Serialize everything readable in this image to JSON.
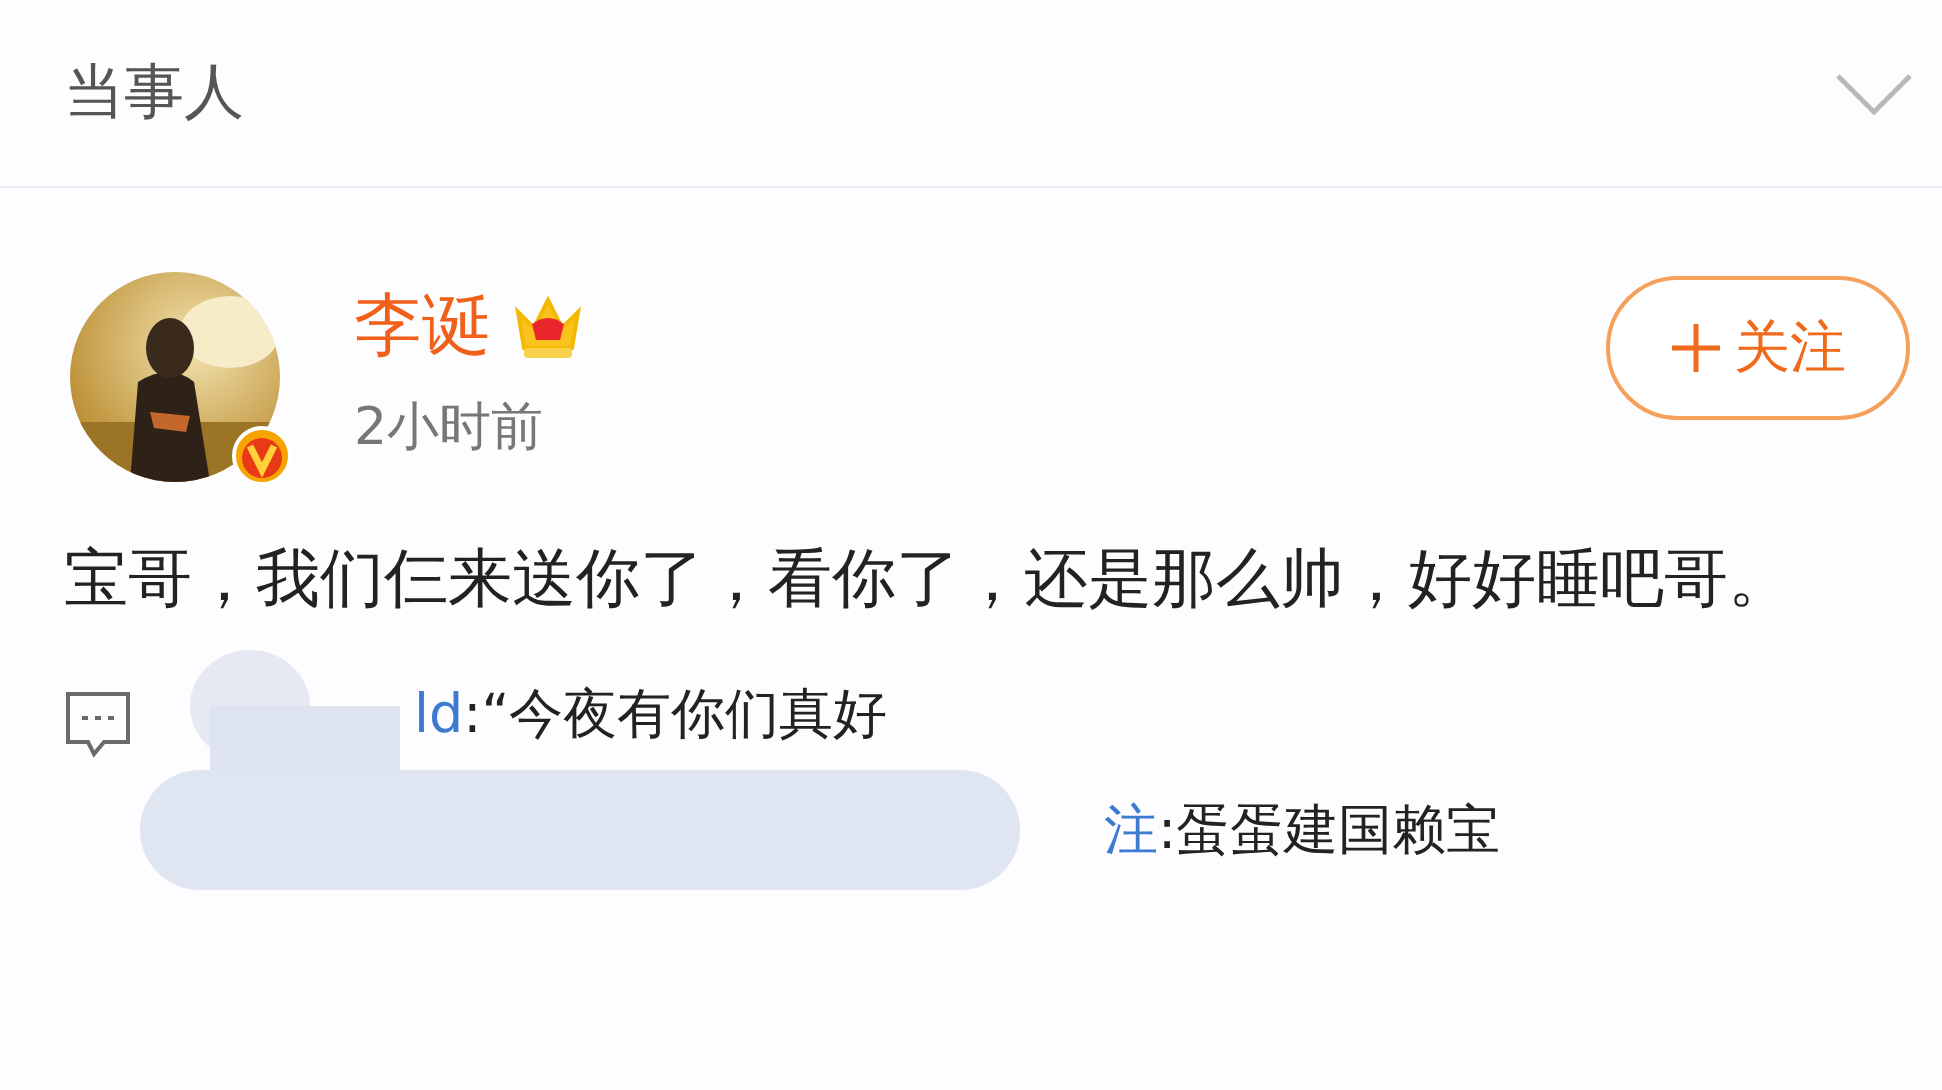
{
  "header": {
    "title": "当事人"
  },
  "post": {
    "author": {
      "name": "李诞",
      "vip": true,
      "verified": true
    },
    "time": "2小时前",
    "follow_button": {
      "label": "关注"
    },
    "text": "宝哥，我们仨来送你了，看你了，还是那么帅，好好睡吧哥。",
    "comments": [
      {
        "user": "ld",
        "text": ":“今夜有你们真好"
      },
      {
        "user": "注",
        "text": ":蛋蛋建国赖宝"
      }
    ]
  }
}
